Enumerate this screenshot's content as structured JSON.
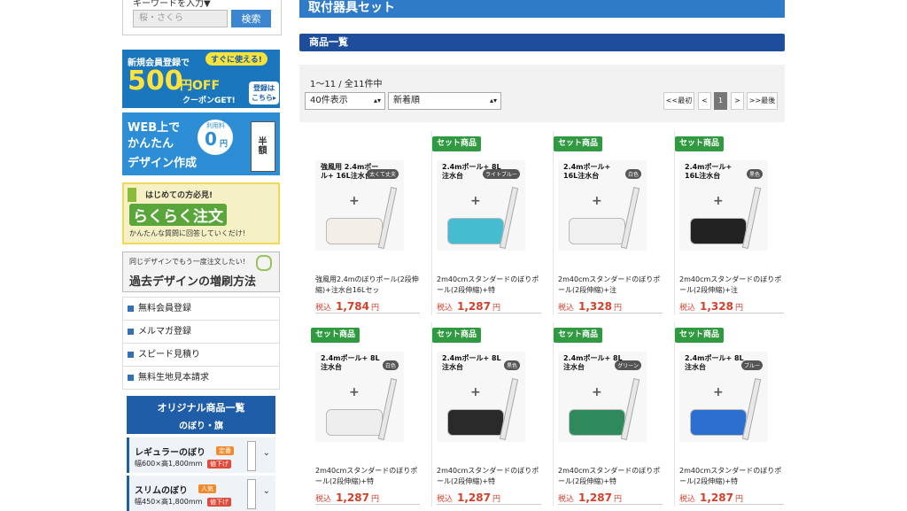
{
  "search": {
    "label": "キーワードを入力▼",
    "placeholder": "桜・さくら",
    "button": "検索"
  },
  "banners": {
    "member": {
      "line1": "新規会員登録で",
      "pill": "すぐに使える!",
      "amount": "500",
      "unit": "円OFF",
      "coupon": "クーポンGET!",
      "side": "登録は こちら▸"
    },
    "design": {
      "line1": "WEB上で",
      "line2": "かんたん",
      "line3": "デザイン作成",
      "fee_label": "利用料",
      "fee": "0",
      "fee_unit": "円",
      "half": "半額"
    },
    "easy": {
      "top": "はじめての方必見!",
      "main": "らくらく注文",
      "sub": "かんたんな質問に回答していくだけ!"
    },
    "reprint": {
      "top": "同じデザインでもう一度注文したい!",
      "main": "過去デザインの増刷方法"
    }
  },
  "side_links": [
    "無料会員登録",
    "メルマガ登録",
    "スピード見積り",
    "無料生地見本請求"
  ],
  "original": {
    "title": "オリジナル商品一覧",
    "subtitle": "のぼり・旗"
  },
  "categories": [
    {
      "name": "レギュラーのぼり",
      "tag": "定番",
      "size": "幅600×高1,800mm",
      "sub_tag": "値下げ"
    },
    {
      "name": "スリムのぼり",
      "tag": "人気",
      "size": "幅450×高1,800mm",
      "sub_tag": "値下げ"
    }
  ],
  "main": {
    "title": "取付器具セット",
    "section": "商品一覧",
    "count": "1～11 / 全11件中",
    "per_page": "40件表示",
    "sort": "新着順",
    "pager": {
      "first": "<<最初",
      "prev": "<",
      "current": "1",
      "next": ">",
      "last": ">>最後"
    }
  },
  "products": [
    {
      "badge": "",
      "name": "強風用2.4mのぼりポール(2段伸縮)+注水台16Lセッ",
      "tax": "税込",
      "price": "1,784",
      "yen": "円",
      "img_title": "強風用 2.4mポール+ 16L注水台",
      "img_tag": "太くて丈夫",
      "base_color": "#f3efe8"
    },
    {
      "badge": "セット商品",
      "name": "2m40cmスタンダードのぼりポール(2段伸縮)+特",
      "tax": "税込",
      "price": "1,287",
      "yen": "円",
      "img_title": "2.4mポール+ 8L注水台",
      "img_tag": "ライトブルー",
      "base_color": "#45bcd0"
    },
    {
      "badge": "セット商品",
      "name": "2m40cmスタンダードのぼりポール(2段伸縮)+注",
      "tax": "税込",
      "price": "1,328",
      "yen": "円",
      "img_title": "2.4mポール+ 16L注水台",
      "img_tag": "白色",
      "base_color": "#f0f0f0"
    },
    {
      "badge": "セット商品",
      "name": "2m40cmスタンダードのぼりポール(2段伸縮)+注",
      "tax": "税込",
      "price": "1,328",
      "yen": "円",
      "img_title": "2.4mポール+ 16L注水台",
      "img_tag": "黒色",
      "base_color": "#222222"
    },
    {
      "badge": "セット商品",
      "name": "2m40cmスタンダードのぼりポール(2段伸縮)+特",
      "tax": "税込",
      "price": "1,287",
      "yen": "円",
      "img_title": "2.4mポール+ 8L注水台",
      "img_tag": "白色",
      "base_color": "#eeeeee"
    },
    {
      "badge": "セット商品",
      "name": "2m40cmスタンダードのぼりポール(2段伸縮)+特",
      "tax": "税込",
      "price": "1,287",
      "yen": "円",
      "img_title": "2.4mポール+ 8L注水台",
      "img_tag": "黒色",
      "base_color": "#2a2a2a"
    },
    {
      "badge": "セット商品",
      "name": "2m40cmスタンダードのぼりポール(2段伸縮)+特",
      "tax": "税込",
      "price": "1,287",
      "yen": "円",
      "img_title": "2.4mポール+ 8L注水台",
      "img_tag": "グリーン",
      "base_color": "#2e8a5a"
    },
    {
      "badge": "セット商品",
      "name": "2m40cmスタンダードのぼりポール(2段伸縮)+特",
      "tax": "税込",
      "price": "1,287",
      "yen": "円",
      "img_title": "2.4mポール+ 8L注水台",
      "img_tag": "ブルー",
      "base_color": "#2d6fd1"
    }
  ]
}
